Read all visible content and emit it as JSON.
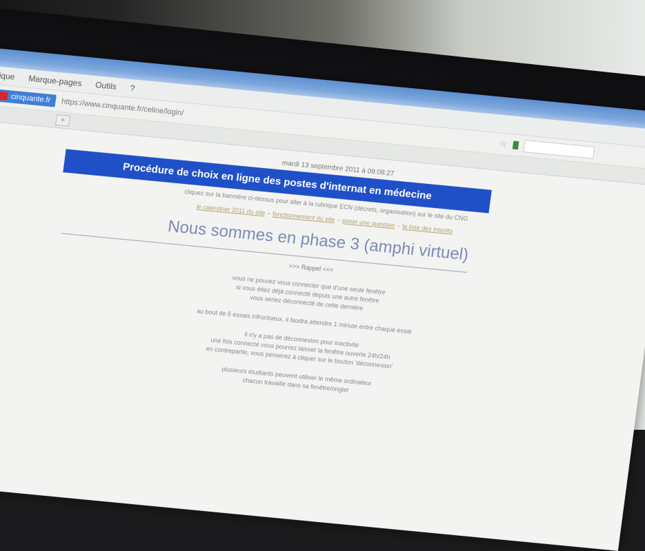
{
  "browser": {
    "menu": [
      "ique",
      "Marque-pages",
      "Outils",
      "?"
    ],
    "site_badge": "cinquante.fr",
    "url": "https://www.cinquante.fr/celine/login/",
    "new_tab_label": "+"
  },
  "page": {
    "date": "mardi 13 septembre 2011 à 09:08:27",
    "banner_title": "Procédure de choix en ligne des postes d'internat en médecine",
    "banner_note": "cliquez sur la bannière ci-dessus pour aller à la rubrique ECN (décrets, organisation) sur le site du CNG",
    "links": [
      "le calendrier 2011 du site",
      "fonctionnement du site",
      "poser une question",
      "la liste des inscrits"
    ],
    "phase_heading": "Nous sommes en phase 3 (amphi virtuel)",
    "rappel": ">>> Rappel <<<",
    "paragraph_1": [
      "vous ne pouvez vous connecter que d'une seule fenêtre",
      "si vous étiez déjà connecté depuis une autre fenêtre",
      "vous seriez déconnecté de cette dernière"
    ],
    "paragraph_2": [
      "au bout de 5 essais infructueux, il faudra attendre 1 minute entre chaque essai"
    ],
    "paragraph_3": [
      "il n'y a pas de déconnexion pour inactivité",
      "une fois connecté vous pourrez laisser la fenêtre ouverte 24h/24h",
      "en contrepartie, vous penserez à cliquer sur le bouton 'déconnexion'"
    ],
    "paragraph_4": [
      "plusieurs étudiants peuvent utiliser le même ordinateur",
      "chacun travaille dans sa fenêtre/onglet"
    ]
  }
}
